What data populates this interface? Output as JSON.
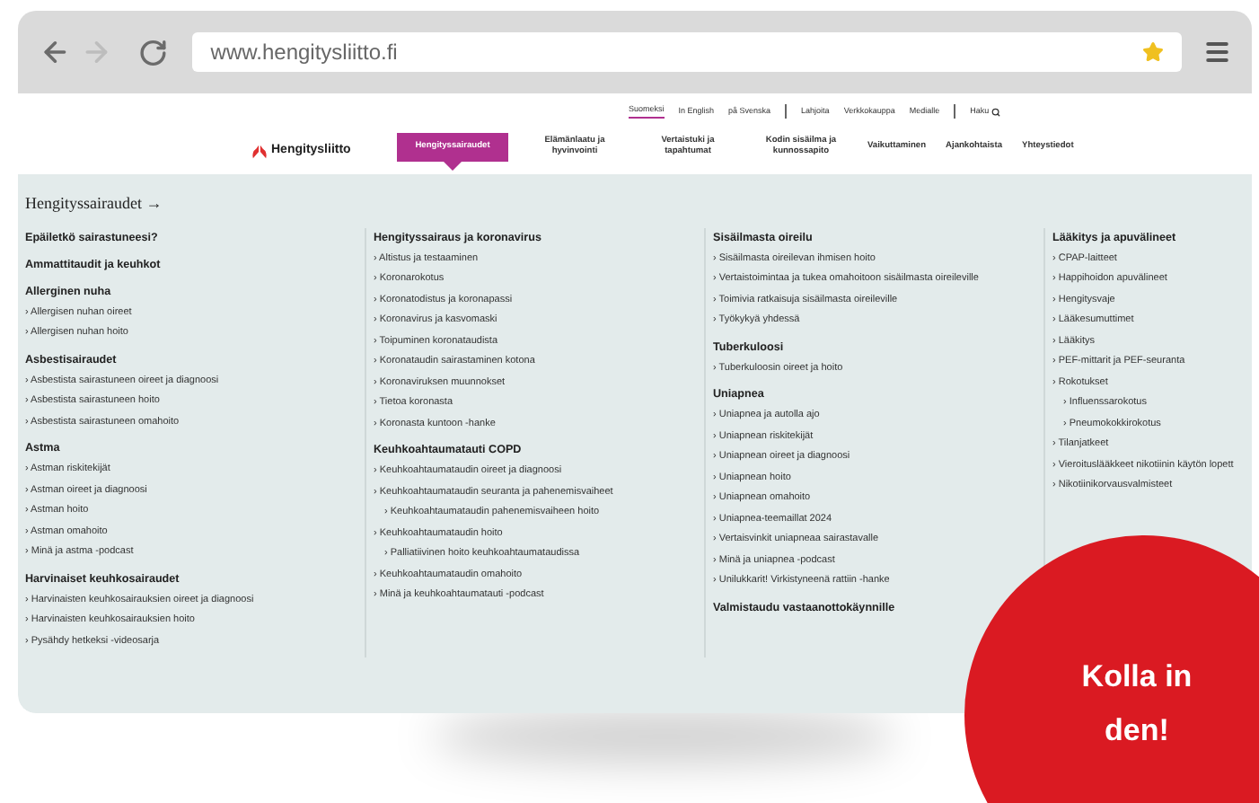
{
  "browser": {
    "url": "www.hengitysliitto.fi"
  },
  "language_links": [
    {
      "label": "Suomeksi",
      "selected": true
    },
    {
      "label": "In English",
      "selected": false
    },
    {
      "label": "på Svenska",
      "selected": false
    }
  ],
  "utility_links": [
    "Lahjoita",
    "Verkkokauppa",
    "Medialle"
  ],
  "search_label": "Haku",
  "logo": "Hengitysliitto",
  "nav": [
    {
      "label": "Hengityssairaudet",
      "selected": true
    },
    {
      "label": "Elämänlaatu ja hyvinvointi",
      "selected": false
    },
    {
      "label": "Vertaistuki ja tapahtumat",
      "selected": false
    },
    {
      "label": "Kodin sisäilma ja kunnossapito",
      "selected": false
    },
    {
      "label": "Vaikuttaminen",
      "selected": false
    },
    {
      "label": "Ajankohtaista",
      "selected": false
    },
    {
      "label": "Yhteystiedot",
      "selected": false
    }
  ],
  "section_title": "Hengityssairaudet →",
  "columns": [
    [
      {
        "heading": "Epäiletkö sairastuneesi?"
      },
      {
        "heading": "Ammattitaudit ja keuhkot"
      },
      {
        "heading": "Allerginen nuha",
        "links": [
          {
            "text": "› Allergisen nuhan oireet"
          },
          {
            "text": "› Allergisen nuhan hoito"
          }
        ]
      },
      {
        "heading": "Asbestisairaudet",
        "links": [
          {
            "text": "› Asbestista sairastuneen oireet ja diagnoosi"
          },
          {
            "text": "› Asbestista sairastuneen hoito"
          },
          {
            "text": "› Asbestista sairastuneen omahoito"
          }
        ]
      },
      {
        "heading": "Astma",
        "links": [
          {
            "text": "› Astman riskitekijät"
          },
          {
            "text": "› Astman oireet ja diagnoosi"
          },
          {
            "text": "› Astman hoito"
          },
          {
            "text": "› Astman omahoito"
          },
          {
            "text": "› Minä ja astma -podcast"
          }
        ]
      },
      {
        "heading": "Harvinaiset keuhkosairaudet",
        "links": [
          {
            "text": "› Harvinaisten keuhkosairauksien oireet ja diagnoosi"
          },
          {
            "text": "› Harvinaisten keuhkosairauksien hoito"
          },
          {
            "text": "› Pysähdy hetkeksi -videosarja"
          }
        ]
      }
    ],
    [
      {
        "heading": "Hengityssairaus ja koronavirus",
        "links": [
          {
            "text": "› Altistus ja testaaminen"
          },
          {
            "text": "› Koronarokotus"
          },
          {
            "text": "› Koronatodistus ja koronapassi"
          },
          {
            "text": "› Koronavirus ja kasvomaski"
          },
          {
            "text": "› Toipuminen koronataudista"
          },
          {
            "text": "› Koronataudin sairastaminen kotona"
          },
          {
            "text": "› Koronaviruksen muunnokset"
          },
          {
            "text": "› Tietoa koronasta"
          },
          {
            "text": "› Koronasta kuntoon -hanke"
          }
        ]
      },
      {
        "heading": "Keuhkoahtaumatauti COPD",
        "links": [
          {
            "text": "› Keuhkoahtaumataudin oireet ja diagnoosi"
          },
          {
            "text": "› Keuhkoahtaumataudin seuranta ja pahenemisvaiheet",
            "children": [
              {
                "text": "› Keuhkoahtaumataudin pahenemisvaiheen hoito"
              }
            ]
          },
          {
            "text": "› Keuhkoahtaumataudin hoito",
            "children": [
              {
                "text": "› Palliatiivinen hoito keuhkoahtaumataudissa"
              }
            ]
          },
          {
            "text": "› Keuhkoahtaumataudin omahoito"
          },
          {
            "text": "› Minä ja keuhkoahtaumatauti -podcast"
          }
        ]
      }
    ],
    [
      {
        "heading": "Sisäilmasta oireilu",
        "links": [
          {
            "text": "› Sisäilmasta oireilevan ihmisen hoito"
          },
          {
            "text": "› Vertaistoimintaa ja tukea omahoitoon sisäilmasta oireileville"
          },
          {
            "text": "› Toimivia ratkaisuja sisäilmasta oireileville"
          },
          {
            "text": "› Työkykyä yhdessä"
          }
        ]
      },
      {
        "heading": "Tuberkuloosi",
        "links": [
          {
            "text": "› Tuberkuloosin oireet ja hoito"
          }
        ]
      },
      {
        "heading": "Uniapnea",
        "links": [
          {
            "text": "› Uniapnea ja autolla ajo"
          },
          {
            "text": "› Uniapnean riskitekijät"
          },
          {
            "text": "› Uniapnean oireet ja diagnoosi"
          },
          {
            "text": "› Uniapnean hoito"
          },
          {
            "text": "› Uniapnean omahoito"
          },
          {
            "text": "› Uniapnea-teemaillat 2024"
          },
          {
            "text": "› Vertaisvinkit uniapneaa sairastavalle"
          },
          {
            "text": "› Minä ja uniapnea -podcast"
          },
          {
            "text": "› Unilukkarit! Virkistyneenä rattiin -hanke"
          }
        ]
      },
      {
        "heading": "Valmistaudu vastaanottokäynnille"
      }
    ],
    [
      {
        "heading": "Lääkitys ja apuvälineet",
        "links": [
          {
            "text": "› CPAP-laitteet"
          },
          {
            "text": "› Happihoidon apuvälineet"
          },
          {
            "text": "› Hengitysvaje"
          },
          {
            "text": "› Lääkesumuttimet"
          },
          {
            "text": "› Lääkitys"
          },
          {
            "text": "› PEF-mittarit ja PEF-seuranta"
          },
          {
            "text": "› Rokotukset",
            "children": [
              {
                "text": "› Influenssarokotus"
              },
              {
                "text": "› Pneumokokkirokotus"
              }
            ]
          },
          {
            "text": "› Tilanjatkeet"
          },
          {
            "text": "› Vieroituslääkkeet nikotiinin käytön lopett"
          },
          {
            "text": "› Nikotiinikorvausvalmisteet"
          }
        ]
      }
    ]
  ],
  "badge": "Kolla in den!"
}
